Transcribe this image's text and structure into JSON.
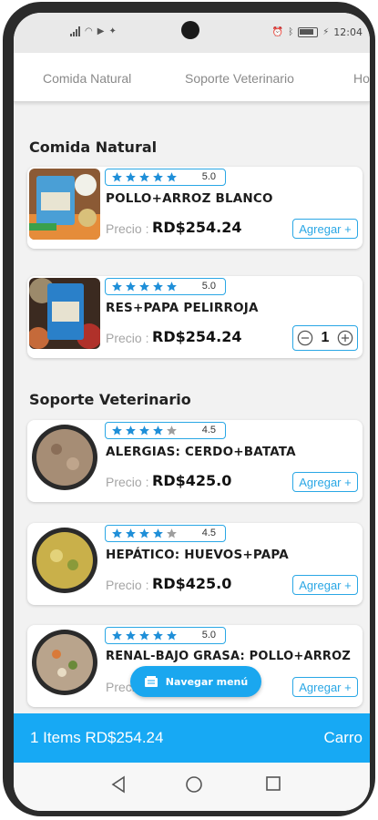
{
  "status_bar": {
    "time": "12:04",
    "battery": "100"
  },
  "tabs": [
    {
      "label": "Comida Natural"
    },
    {
      "label": "Soporte Veterinario"
    },
    {
      "label": "Ho"
    }
  ],
  "sections": [
    {
      "title": "Comida Natural",
      "products": [
        {
          "rating": "5.0",
          "stars": 5,
          "name": "POLLO+ARROZ BLANCO",
          "price_label": "Precio :",
          "price": "RD$254.24",
          "action": "Agregar +"
        },
        {
          "rating": "5.0",
          "stars": 5,
          "name": "RES+PAPA PELIRROJA",
          "price_label": "Precio :",
          "price": "RD$254.24",
          "quantity": "1"
        }
      ]
    },
    {
      "title": "Soporte Veterinario",
      "products": [
        {
          "rating": "4.5",
          "stars": 4,
          "name": "ALERGIAS: CERDO+BATATA",
          "price_label": "Precio :",
          "price": "RD$425.0",
          "action": "Agregar +"
        },
        {
          "rating": "4.5",
          "stars": 4,
          "name": "HEPÁTICO: HUEVOS+PAPA",
          "price_label": "Precio :",
          "price": "RD$425.0",
          "action": "Agregar +"
        },
        {
          "rating": "5.0",
          "stars": 5,
          "name": "RENAL-BAJO GRASA: POLLO+ARROZ",
          "price_label": "Precio",
          "price": "",
          "action": "Agregar +"
        }
      ]
    }
  ],
  "nav_button": {
    "label": "Navegar menú"
  },
  "cart": {
    "summary": "1 Items RD$254.24",
    "button": "Carro"
  },
  "colors": {
    "accent": "#1aa7ef",
    "star": "#1f8fd8",
    "star_off": "#9e9e9e"
  }
}
